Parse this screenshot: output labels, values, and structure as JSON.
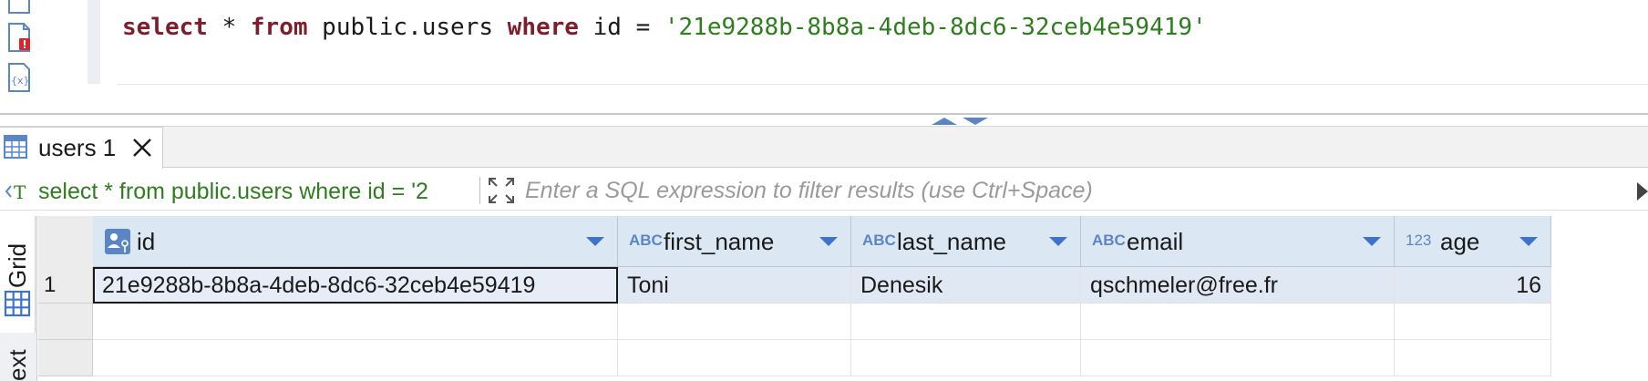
{
  "editor": {
    "sql_tokens": [
      {
        "t": "select",
        "k": "kw"
      },
      {
        "t": " * ",
        "k": "plain"
      },
      {
        "t": "from",
        "k": "kw"
      },
      {
        "t": " public.users ",
        "k": "plain"
      },
      {
        "t": "where",
        "k": "kw"
      },
      {
        "t": " id = ",
        "k": "plain"
      },
      {
        "t": "'21e9288b-8b8a-4deb-8dc6-32ceb4e59419'",
        "k": "str"
      }
    ],
    "gutter_icons": [
      "script-icon",
      "script-error-icon",
      "variables-icon"
    ]
  },
  "results": {
    "tab_label": "users 1",
    "filter_query": "select * from public.users where id = '2",
    "filter_placeholder": "Enter a SQL expression to filter results (use Ctrl+Space)",
    "side_tabs": {
      "grid": "Grid",
      "text": "ext"
    },
    "columns": [
      {
        "name": "id",
        "type": "key"
      },
      {
        "name": "first_name",
        "type": "ABC"
      },
      {
        "name": "last_name",
        "type": "ABC"
      },
      {
        "name": "email",
        "type": "ABC"
      },
      {
        "name": "age",
        "type": "123"
      }
    ],
    "rows": [
      {
        "num": "1",
        "cells": [
          "21e9288b-8b8a-4deb-8dc6-32ceb4e59419",
          "Toni",
          "Denesik",
          "qschmeler@free.fr",
          "16"
        ]
      }
    ]
  },
  "colors": {
    "keyword": "#7b1f2d",
    "string": "#2e7d1e",
    "header_bg": "#dce7f4",
    "type_badge": "#5b86c5"
  }
}
